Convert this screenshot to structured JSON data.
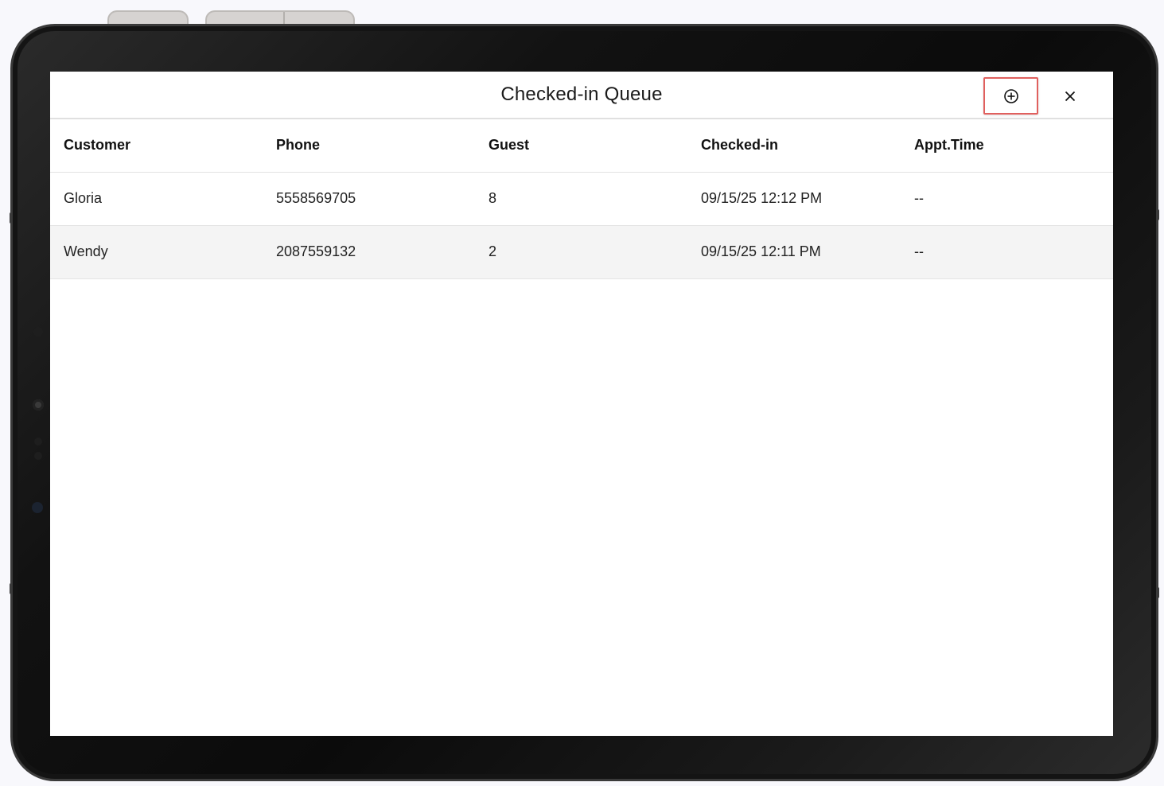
{
  "dialog": {
    "title": "Checked-in Queue",
    "add_icon": "plus-circle-icon",
    "close_icon": "close-icon"
  },
  "table": {
    "headers": [
      "Customer",
      "Phone",
      "Guest",
      "Checked-in",
      "Appt.Time"
    ],
    "rows": [
      [
        "Gloria",
        "5558569705",
        "8",
        "09/15/25 12:12 PM",
        "--"
      ],
      [
        "Wendy",
        "2087559132",
        "2",
        "09/15/25 12:11 PM",
        "--"
      ]
    ]
  },
  "colors": {
    "highlight_border": "#e0605e",
    "alt_row_bg": "#f4f4f4"
  }
}
